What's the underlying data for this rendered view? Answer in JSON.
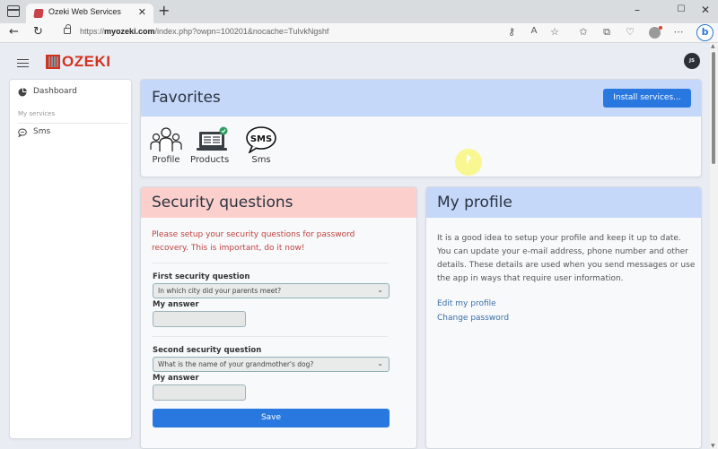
{
  "browser": {
    "tab_title": "Ozeki Web Services",
    "url_prefix": "https://",
    "url_domain": "myozeki.com",
    "url_path": "/index.php?owpn=100201&nocache=TuIvkNgshf",
    "window_controls": {
      "minimize": "–",
      "maximize": "☐",
      "close": "✕"
    },
    "toolbar_icons": [
      "password-key-icon",
      "read-aloud-icon",
      "favorite-star-icon",
      "favorites-icon",
      "collections-icon",
      "browser-essentials-icon",
      "profile-icon",
      "more-icon",
      "bing-icon"
    ]
  },
  "header": {
    "logo_text": "OZEKI",
    "user_initials": "JS"
  },
  "sidebar": {
    "items": [
      {
        "label": "Dashboard",
        "icon": "pie-chart-icon"
      }
    ],
    "section_label": "My services",
    "services": [
      {
        "label": "Sms",
        "icon": "chat-bubble-icon"
      }
    ]
  },
  "favorites": {
    "title": "Favorites",
    "install_button": "Install services...",
    "items": [
      {
        "label": "Profile",
        "icon": "people-icon"
      },
      {
        "label": "Products",
        "icon": "laptop-check-icon"
      },
      {
        "label": "Sms",
        "icon": "sms-bubble-icon"
      }
    ]
  },
  "security": {
    "title": "Security questions",
    "warning": "Please setup your security questions for password recovery. This is important, do it now!",
    "first_label": "First security question",
    "first_value": "In which city did your parents meet?",
    "answer_label": "My answer",
    "first_answer": "",
    "second_label": "Second security question",
    "second_value": "What is the name of your grandmother's dog?",
    "second_answer": "",
    "save_label": "Save",
    "accent": "#2878e0",
    "warning_color": "#c0433e"
  },
  "profile": {
    "title": "My profile",
    "description": "It is a good idea to setup your profile and keep it up to date. You can update your e-mail address, phone number and other details. These details are used when you send messages or use the app in ways that require user information.",
    "links": [
      "Edit my profile",
      "Change password"
    ]
  }
}
